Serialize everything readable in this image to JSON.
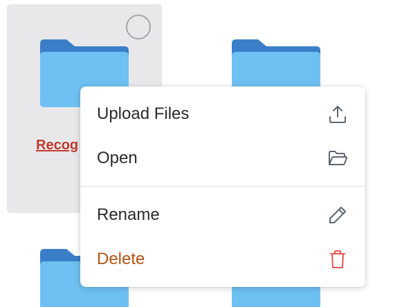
{
  "files": [
    {
      "name": "Recog",
      "selected": true
    },
    {
      "name": ""
    },
    {
      "name": ""
    },
    {
      "name": ""
    }
  ],
  "context_menu": {
    "items": [
      {
        "label": "Upload Files",
        "icon": "upload-icon"
      },
      {
        "label": "Open",
        "icon": "folder-open-icon"
      },
      {
        "label": "Rename",
        "icon": "pencil-icon"
      },
      {
        "label": "Delete",
        "icon": "trash-icon",
        "color": "#b5530f"
      }
    ]
  },
  "colors": {
    "folder_front": "#6ec0f3",
    "folder_back": "#3a7ec8",
    "selected_tile": "#e8e8ea",
    "file_name": "#c0392b",
    "delete_text": "#b5530f",
    "delete_icon": "#e5574f"
  }
}
